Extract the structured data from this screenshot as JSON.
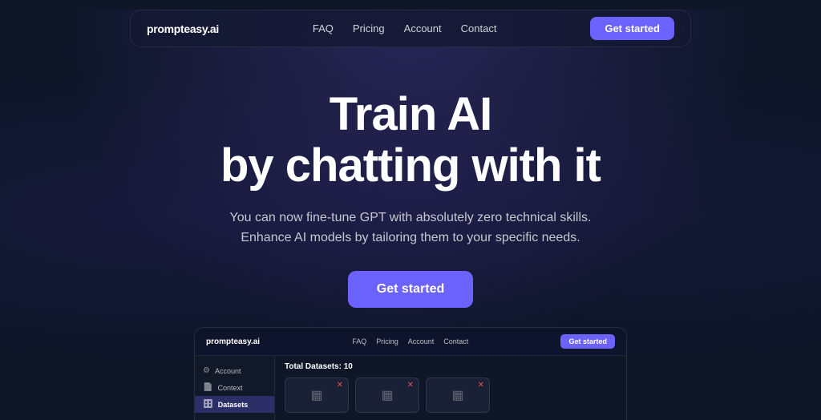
{
  "navbar": {
    "logo": "prompteasy.ai",
    "links": [
      {
        "label": "FAQ",
        "id": "faq"
      },
      {
        "label": "Pricing",
        "id": "pricing"
      },
      {
        "label": "Account",
        "id": "account"
      },
      {
        "label": "Contact",
        "id": "contact"
      }
    ],
    "cta_label": "Get started"
  },
  "hero": {
    "title_line1": "Train AI",
    "title_line2": "by chatting with it",
    "subtitle_line1": "You can now fine-tune GPT with absolutely zero technical skills.",
    "subtitle_line2": "Enhance AI models by tailoring them to your specific needs.",
    "cta_label": "Get started"
  },
  "preview": {
    "logo": "prompteasy.ai",
    "links": [
      "FAQ",
      "Pricing",
      "Account",
      "Contact"
    ],
    "cta_label": "Get started",
    "sidebar": [
      {
        "label": "Account",
        "icon": "⚙",
        "active": false
      },
      {
        "label": "Context",
        "icon": "📄",
        "active": false
      },
      {
        "label": "Datasets",
        "icon": "🗄",
        "active": true
      }
    ],
    "main_title": "Total Datasets: 10"
  },
  "colors": {
    "accent": "#6c63ff",
    "bg": "#0e1628"
  }
}
